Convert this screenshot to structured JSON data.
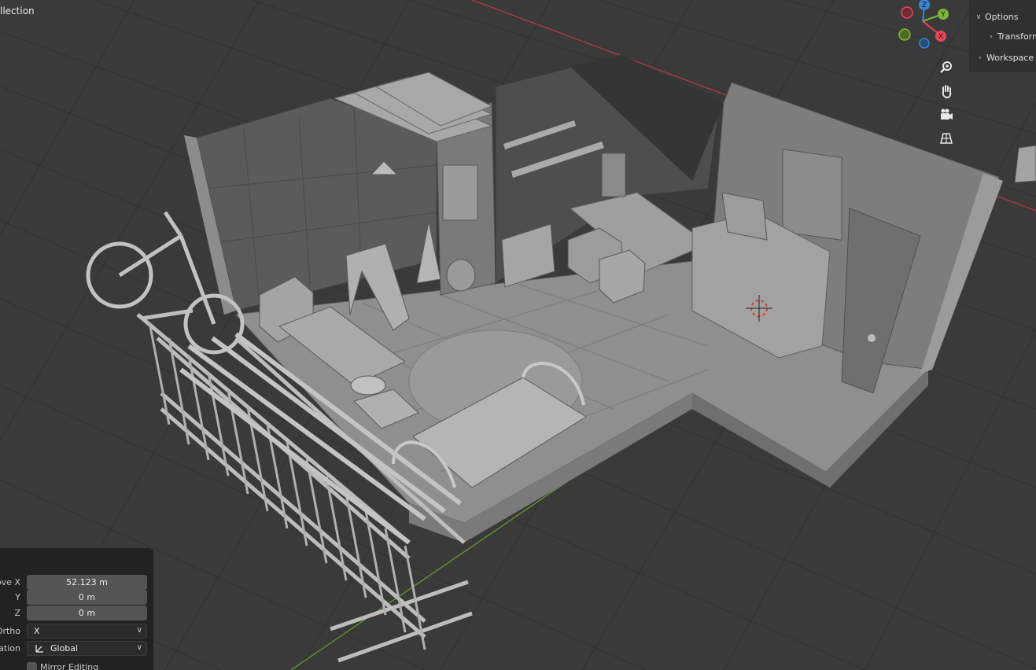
{
  "header": {
    "collection_label": "llection"
  },
  "gizmo": {
    "axes": [
      "Z",
      "Y",
      "X"
    ],
    "colors": {
      "x": "#e8465a",
      "y": "#7fb43a",
      "z": "#3b84d6"
    }
  },
  "nav_tools": [
    "zoom-icon",
    "hand-icon",
    "camera-icon",
    "grid-perspective-icon"
  ],
  "side_panel": {
    "items": [
      {
        "label": "Options",
        "state": "expanded"
      },
      {
        "label": "Transform",
        "state": "collapsed"
      },
      {
        "label": "Workspace",
        "state": "collapsed"
      }
    ]
  },
  "operator_panel": {
    "fields": {
      "move_x_label": "ove X",
      "move_x_value": "52.123 m",
      "y_label": "Y",
      "y_value": "0 m",
      "z_label": "Z",
      "z_value": "0 m",
      "ortho_label": "Ortho",
      "ortho_value": "X",
      "orientation_label": "ation",
      "orientation_value": "Global",
      "mirror_label": "Mirror Editing"
    }
  },
  "colors": {
    "viewport_bg": "#3a3a3a",
    "grid_line": "#2e2e2e",
    "x_axis": "#d03a3a",
    "y_axis": "#6cb42f",
    "model": "#9b9b9b",
    "panel_bg": "#222222",
    "field_bg": "#545454"
  }
}
